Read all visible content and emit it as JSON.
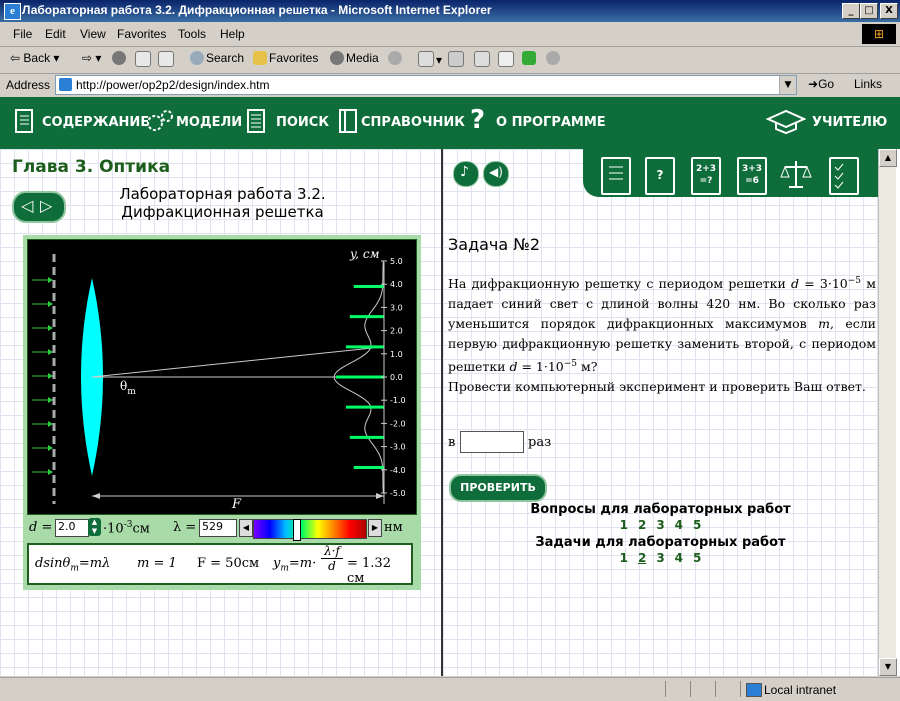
{
  "window": {
    "title": "Лабораторная работа 3.2. Дифракционная решетка - Microsoft Internet Explorer",
    "min": "_",
    "max": "□",
    "close": "X"
  },
  "menu": [
    "File",
    "Edit",
    "View",
    "Favorites",
    "Tools",
    "Help"
  ],
  "toolbar": {
    "back": "Back",
    "search": "Search",
    "favorites": "Favorites",
    "media": "Media"
  },
  "address": {
    "label": "Address",
    "url": "http://power/op2p2/design/index.htm",
    "go": "Go",
    "links": "Links"
  },
  "nav": {
    "items": [
      "СОДЕРЖАНИЕ",
      "МОДЕЛИ",
      "ПОИСК",
      "СПРАВОЧНИК",
      "О ПРОГРАММЕ"
    ],
    "teacher": "УЧИТЕЛЮ"
  },
  "left": {
    "chapter": "Глава 3. Оптика",
    "lab_title_1": "Лабораторная работа 3.2.",
    "lab_title_2": "Дифракционная решетка",
    "sim": {
      "y_axis_label": "y, см",
      "ticks": [
        "5.0",
        "4.0",
        "3.0",
        "2.0",
        "1.0",
        "0.0",
        "-1.0",
        "-2.0",
        "-3.0",
        "-4.0",
        "-5.0"
      ],
      "theta_label": "θ",
      "theta_sub": "m",
      "f_label": "F",
      "maxima_y": [
        0.0,
        1.3,
        2.6,
        3.9,
        -1.3,
        -2.6,
        -3.9
      ],
      "line_color": "#00ff66",
      "lens_color": "#00ffff"
    },
    "controls": {
      "d_label": "d =",
      "d_value": "2.0",
      "d_unit": "·10",
      "d_exp": "-3",
      "d_unit2": "см",
      "lambda_label": "λ =",
      "lambda_value": "529",
      "lambda_unit": "нм"
    },
    "formula": {
      "f1": "dsinθ",
      "f1_sub": "m",
      "f1_rest": "=mλ",
      "m": "m = 1",
      "F": "F = 50см",
      "ym": "y",
      "ym_sub": "m",
      "ym_eq": "=m·",
      "frac_num": "λ·f",
      "frac_den": "d",
      "result": "= 1.32 см"
    }
  },
  "right": {
    "task_title": "Задача №2",
    "task_line1a": "На дифракционную решетку с периодом решетки ",
    "task_d1": "d",
    "task_d1_val": " = 3·10",
    "task_d1_exp": "−5",
    "task_d1_unit": " м",
    "task_line2": " падает синий свет с длиной волны 420 нм. Во сколько раз уменьшится порядок дифракционных максимумов ",
    "task_m": "m",
    "task_line3": ", если первую дифракционную решетку заменить второй, с периодом решетки ",
    "task_d2": "d",
    "task_d2_val": " = 1·10",
    "task_d2_exp": "−5",
    "task_d2_unit": " м?",
    "task_line4": "Провести компьютерный эксперимент и проверить Ваш ответ.",
    "answer_prefix": "в",
    "answer_suffix": "раз",
    "check_button": "ПРОВЕРИТЬ",
    "questions_title": "Вопросы для лабораторных работ",
    "questions": [
      "1",
      "2",
      "3",
      "4",
      "5"
    ],
    "tasks_title": "Задачи для лабораторных работ",
    "tasks": [
      "1",
      "2",
      "3",
      "4",
      "5"
    ],
    "tool_labels": [
      "",
      "?",
      "2+3\n=?",
      "3+3\n=6",
      "",
      ""
    ]
  },
  "status": {
    "zone": "Local intranet"
  }
}
